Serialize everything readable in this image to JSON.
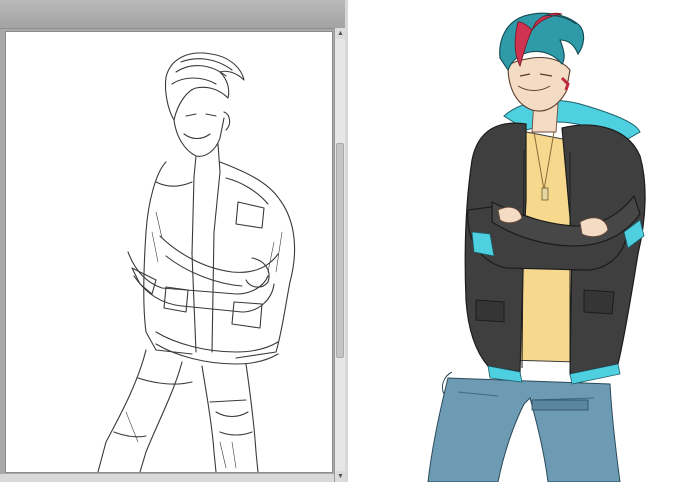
{
  "left_window": {
    "canvas": {
      "subject": "lineart-sketch"
    },
    "scrollbar": {
      "up_icon": "▲",
      "down_icon": "▼"
    }
  },
  "right_panel": {
    "subject": "colored-illustration"
  },
  "colors": {
    "hair_teal": "#2f9aa8",
    "hair_red": "#d0334f",
    "jacket": "#3f3f3f",
    "hood_cyan": "#4fd0e0",
    "shirt": "#f7d98e",
    "jeans": "#6d9bb3",
    "skin": "#f4dcc4"
  }
}
